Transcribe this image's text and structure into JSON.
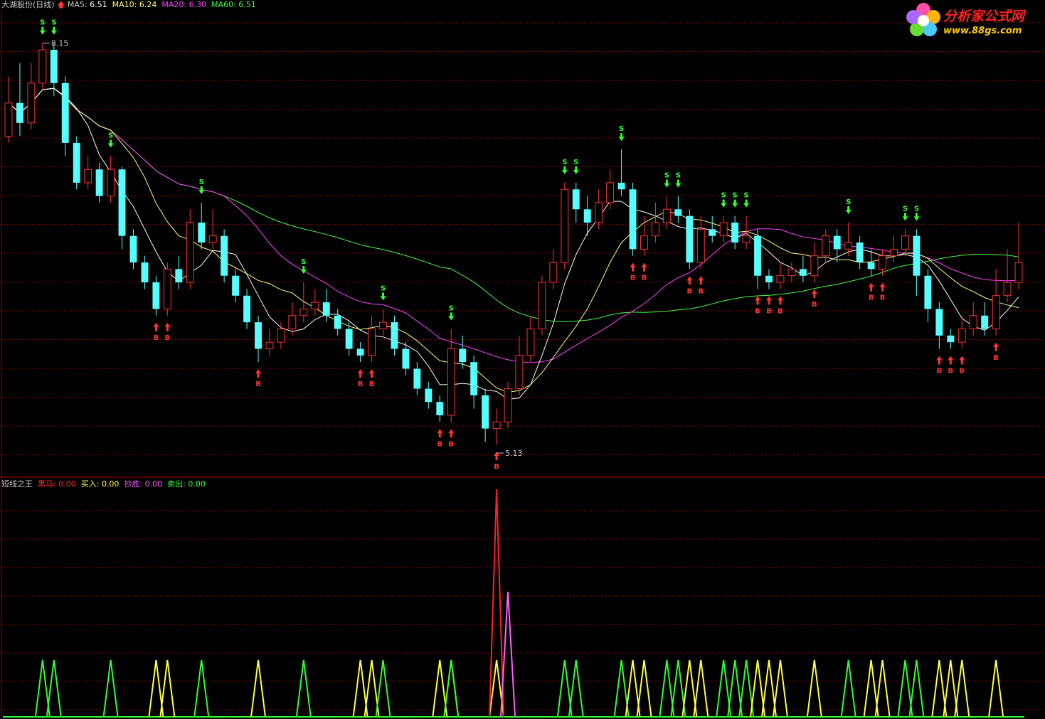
{
  "main_header": {
    "title": "大湖股份(日线)",
    "ma5_label": "MA5:",
    "ma5_value": "6.51",
    "ma10_label": "MA10:",
    "ma10_value": "6.24",
    "ma20_label": "MA20:",
    "ma20_value": "6.30",
    "ma60_label": "MA60:",
    "ma60_value": "6.51"
  },
  "sub_header": {
    "title": "短线之王",
    "heima_label": "黑马:",
    "heima_value": "0.00",
    "buy_label": "买入:",
    "buy_value": "0.00",
    "chaodi_label": "抄底:",
    "chaodi_value": "0.00",
    "sell_label": "卖出:",
    "sell_value": "0.00"
  },
  "logo": {
    "name": "分析家公式网",
    "url": "www.88gs.com"
  },
  "colors": {
    "up": "#ff3232",
    "down": "#54ffff",
    "grid": "#8b0000",
    "ma5": "#ffffff",
    "ma10": "#ffff7a",
    "ma20": "#ff40ff",
    "ma60": "#40ff40",
    "heima": "#ff2020",
    "buy": "#ffff40",
    "chaodi": "#ff60ff",
    "sell": "#30ff30"
  },
  "chart_data": [
    {
      "type": "candlestick",
      "ylim": [
        4.9,
        8.4
      ],
      "annotations": {
        "high": "8.15",
        "low": "5.13"
      },
      "signal_letters": {
        "buy": "B",
        "sell": "S"
      },
      "candles": [
        [
          7.45,
          7.7,
          7.9,
          7.4
        ],
        [
          7.7,
          7.55,
          8.0,
          7.45
        ],
        [
          7.55,
          7.85,
          8.0,
          7.5
        ],
        [
          7.85,
          8.1,
          8.15,
          7.8
        ],
        [
          8.1,
          7.85,
          8.15,
          7.75
        ],
        [
          7.85,
          7.4,
          7.9,
          7.3
        ],
        [
          7.4,
          7.1,
          7.45,
          7.05
        ],
        [
          7.1,
          7.2,
          7.3,
          7.05
        ],
        [
          7.2,
          7.0,
          7.25,
          6.95
        ],
        [
          7.0,
          7.2,
          7.3,
          6.95
        ],
        [
          7.2,
          6.7,
          7.22,
          6.6
        ],
        [
          6.7,
          6.5,
          6.75,
          6.45
        ],
        [
          6.5,
          6.35,
          6.55,
          6.3
        ],
        [
          6.35,
          6.15,
          6.4,
          6.1
        ],
        [
          6.15,
          6.45,
          6.5,
          6.1
        ],
        [
          6.45,
          6.35,
          6.55,
          6.3
        ],
        [
          6.35,
          6.8,
          6.9,
          6.3
        ],
        [
          6.8,
          6.65,
          6.95,
          6.6
        ],
        [
          6.65,
          6.7,
          6.9,
          6.6
        ],
        [
          6.7,
          6.4,
          6.75,
          6.35
        ],
        [
          6.4,
          6.25,
          6.45,
          6.2
        ],
        [
          6.25,
          6.05,
          6.3,
          6.0
        ],
        [
          6.05,
          5.85,
          6.1,
          5.75
        ],
        [
          5.85,
          5.9,
          6.0,
          5.8
        ],
        [
          5.9,
          6.0,
          6.05,
          5.85
        ],
        [
          6.0,
          6.1,
          6.2,
          5.95
        ],
        [
          6.1,
          6.15,
          6.35,
          6.05
        ],
        [
          6.15,
          6.2,
          6.3,
          6.1
        ],
        [
          6.2,
          6.1,
          6.3,
          6.05
        ],
        [
          6.1,
          6.0,
          6.15,
          5.95
        ],
        [
          6.0,
          5.85,
          6.05,
          5.8
        ],
        [
          5.85,
          5.8,
          5.9,
          5.75
        ],
        [
          5.8,
          6.0,
          6.1,
          5.75
        ],
        [
          6.0,
          6.05,
          6.15,
          5.95
        ],
        [
          6.05,
          5.85,
          6.1,
          5.8
        ],
        [
          5.85,
          5.7,
          5.9,
          5.65
        ],
        [
          5.7,
          5.55,
          5.75,
          5.5
        ],
        [
          5.55,
          5.45,
          5.6,
          5.4
        ],
        [
          5.45,
          5.35,
          5.5,
          5.3
        ],
        [
          5.35,
          5.85,
          6.0,
          5.3
        ],
        [
          5.85,
          5.75,
          5.95,
          5.7
        ],
        [
          5.75,
          5.5,
          5.8,
          5.4
        ],
        [
          5.5,
          5.25,
          5.55,
          5.15
        ],
        [
          5.25,
          5.3,
          5.4,
          5.13
        ],
        [
          5.3,
          5.55,
          5.6,
          5.25
        ],
        [
          5.55,
          5.8,
          5.95,
          5.5
        ],
        [
          5.8,
          6.0,
          6.1,
          5.75
        ],
        [
          6.0,
          6.35,
          6.4,
          5.95
        ],
        [
          6.35,
          6.5,
          6.6,
          6.3
        ],
        [
          6.5,
          7.05,
          7.1,
          6.45
        ],
        [
          7.05,
          6.9,
          7.1,
          6.8
        ],
        [
          6.9,
          6.8,
          7.0,
          6.7
        ],
        [
          6.8,
          6.95,
          7.05,
          6.75
        ],
        [
          6.95,
          7.1,
          7.2,
          6.9
        ],
        [
          7.1,
          7.05,
          7.35,
          7.0
        ],
        [
          7.05,
          6.6,
          7.1,
          6.55
        ],
        [
          6.6,
          6.7,
          6.85,
          6.55
        ],
        [
          6.7,
          6.8,
          6.95,
          6.65
        ],
        [
          6.8,
          6.9,
          7.0,
          6.75
        ],
        [
          6.9,
          6.85,
          7.0,
          6.8
        ],
        [
          6.85,
          6.5,
          6.9,
          6.45
        ],
        [
          6.5,
          6.75,
          6.85,
          6.45
        ],
        [
          6.75,
          6.7,
          6.85,
          6.65
        ],
        [
          6.7,
          6.8,
          6.85,
          6.65
        ],
        [
          6.8,
          6.65,
          6.85,
          6.6
        ],
        [
          6.65,
          6.7,
          6.85,
          6.6
        ],
        [
          6.7,
          6.4,
          6.75,
          6.3
        ],
        [
          6.4,
          6.35,
          6.45,
          6.3
        ],
        [
          6.35,
          6.4,
          6.5,
          6.3
        ],
        [
          6.4,
          6.45,
          6.5,
          6.35
        ],
        [
          6.45,
          6.4,
          6.55,
          6.35
        ],
        [
          6.4,
          6.55,
          6.65,
          6.35
        ],
        [
          6.55,
          6.7,
          6.75,
          6.5
        ],
        [
          6.7,
          6.6,
          6.75,
          6.5
        ],
        [
          6.6,
          6.65,
          6.8,
          6.55
        ],
        [
          6.65,
          6.5,
          6.7,
          6.45
        ],
        [
          6.5,
          6.45,
          6.6,
          6.4
        ],
        [
          6.45,
          6.55,
          6.6,
          6.4
        ],
        [
          6.55,
          6.6,
          6.7,
          6.5
        ],
        [
          6.6,
          6.7,
          6.75,
          6.55
        ],
        [
          6.7,
          6.4,
          6.75,
          6.25
        ],
        [
          6.4,
          6.15,
          6.45,
          6.05
        ],
        [
          6.15,
          5.95,
          6.2,
          5.85
        ],
        [
          5.95,
          5.9,
          6.0,
          5.85
        ],
        [
          5.9,
          6.0,
          6.1,
          5.85
        ],
        [
          6.0,
          6.1,
          6.2,
          5.95
        ],
        [
          6.1,
          6.0,
          6.2,
          5.95
        ],
        [
          6.0,
          6.25,
          6.45,
          5.95
        ],
        [
          6.25,
          6.35,
          6.6,
          6.2
        ],
        [
          6.35,
          6.5,
          6.8,
          6.3
        ]
      ]
    },
    {
      "type": "line",
      "ylim": [
        0,
        1
      ],
      "series": [
        {
          "key": "heima",
          "values": []
        },
        {
          "key": "buy",
          "values": []
        },
        {
          "key": "chaodi",
          "values": []
        },
        {
          "key": "sell",
          "values": []
        }
      ]
    }
  ]
}
